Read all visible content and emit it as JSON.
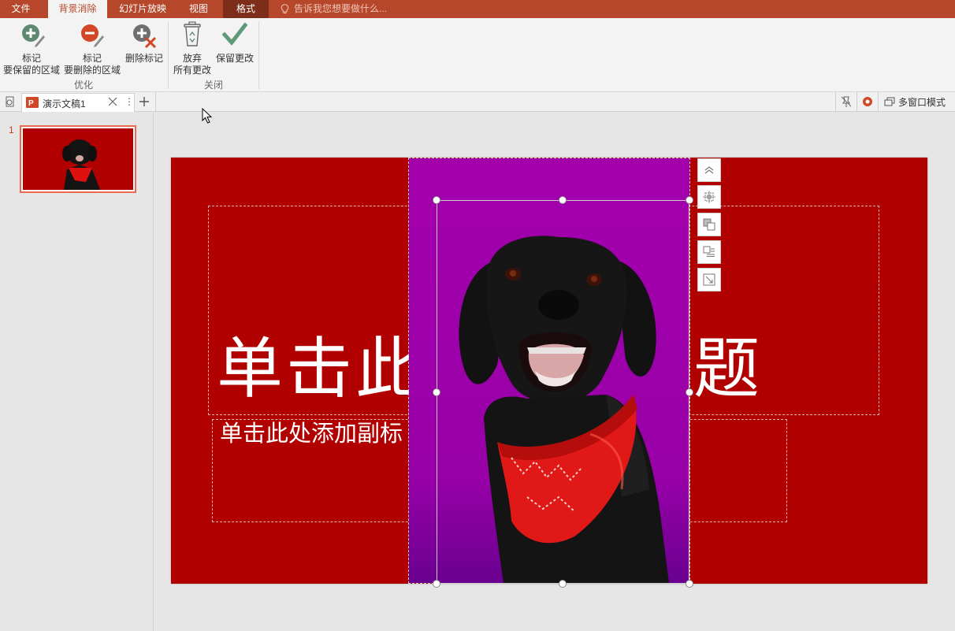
{
  "tabs": {
    "file": "文件",
    "bg_remove": "背景消除",
    "slideshow": "幻灯片放映",
    "view": "视图",
    "format": "格式",
    "tell_me": "告诉我您想要做什么..."
  },
  "ribbon": {
    "mark_keep_line1": "标记",
    "mark_keep_line2": "要保留的区域",
    "mark_remove_line1": "标记",
    "mark_remove_line2": "要删除的区域",
    "delete_mark": "删除标记",
    "discard_line1": "放弃",
    "discard_line2": "所有更改",
    "keep_changes": "保留更改",
    "group_refine": "优化",
    "group_close": "关闭"
  },
  "doc": {
    "tab_name": "演示文稿1",
    "multi_window": "多窗口模式"
  },
  "thumbs": {
    "slide_number": "1"
  },
  "slide": {
    "title_left": "单击此",
    "title_right": "题",
    "subtitle": "单击此处添加副标"
  },
  "colors": {
    "accent": "#b7472a",
    "slide_bg": "#b00000",
    "photo_bg": "#a000a8"
  }
}
